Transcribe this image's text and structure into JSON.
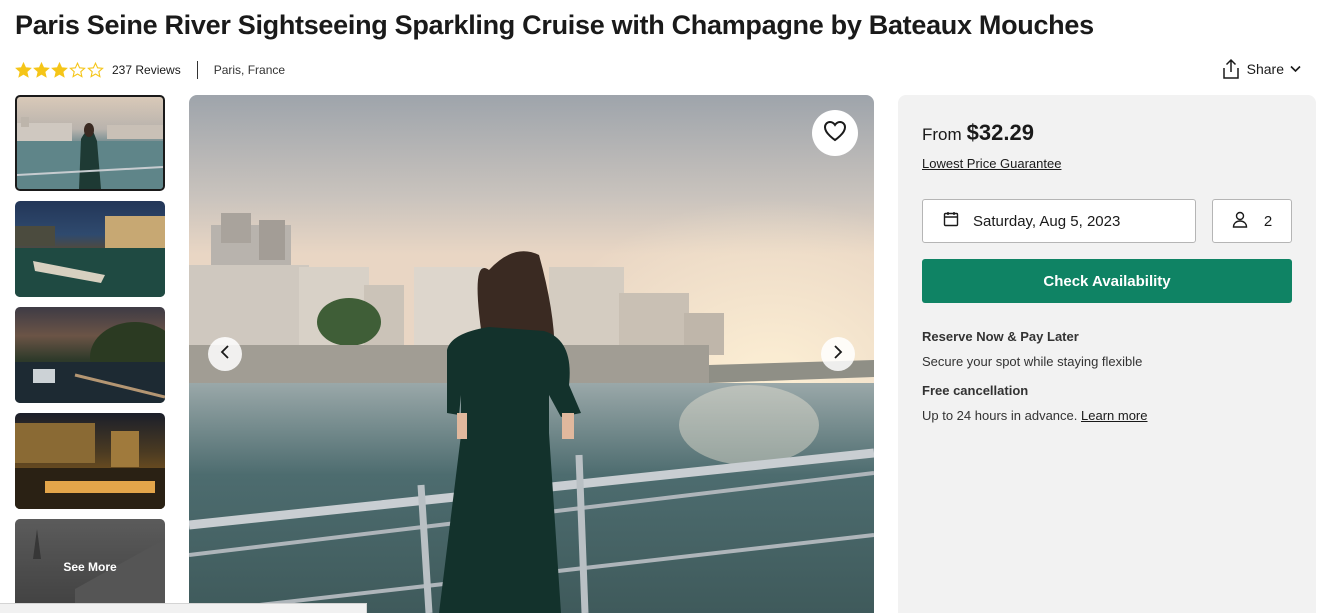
{
  "product": {
    "title": "Paris Seine River Sightseeing Sparkling Cruise with Champagne by Bateaux Mouches",
    "rating_stars": 3,
    "rating_max": 5,
    "reviews_label": "237 Reviews",
    "location": "Paris, France"
  },
  "share": {
    "label": "Share"
  },
  "gallery": {
    "thumbnails": [
      "thumb-1",
      "thumb-2",
      "thumb-3",
      "thumb-4",
      "thumb-5"
    ],
    "see_more_label": "See More",
    "active_index": 0
  },
  "booking": {
    "from_label": "From",
    "price": "$32.29",
    "guarantee_label": "Lowest Price Guarantee",
    "date_value": "Saturday, Aug 5, 2023",
    "guests_value": "2",
    "check_button_label": "Check Availability",
    "reserve_title": "Reserve Now & Pay Later",
    "reserve_text": "Secure your spot while staying flexible",
    "cancel_title": "Free cancellation",
    "cancel_text": "Up to 24 hours in advance.",
    "learn_more_label": "Learn more"
  },
  "colors": {
    "star_filled": "#f5c518",
    "cta_green": "#0f8364",
    "panel_bg": "#f2f2f2"
  },
  "icons": [
    "star-icon",
    "share-icon",
    "chevron-down-icon",
    "heart-icon",
    "chevron-left-icon",
    "chevron-right-icon",
    "calendar-icon",
    "user-icon"
  ]
}
